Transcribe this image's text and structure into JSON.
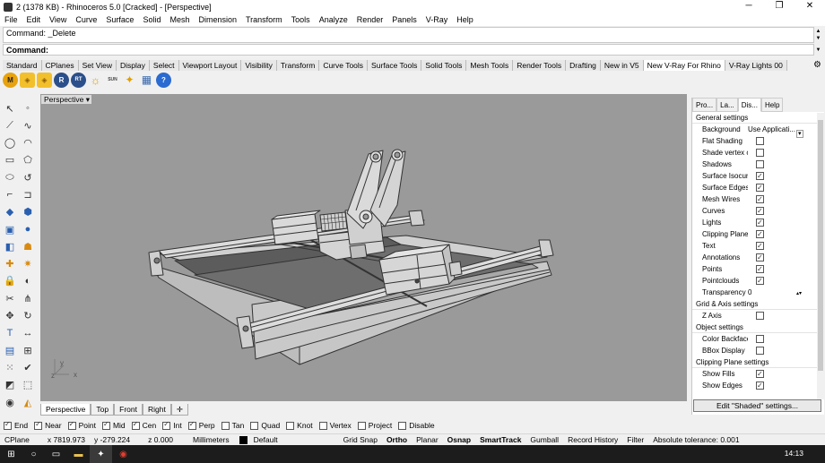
{
  "window": {
    "title": "2 (1378 KB) - Rhinoceros 5.0 [Cracked] - [Perspective]",
    "minimize": "─",
    "maximize": "❐",
    "close": "✕"
  },
  "menu": [
    "File",
    "Edit",
    "View",
    "Curve",
    "Surface",
    "Solid",
    "Mesh",
    "Dimension",
    "Transform",
    "Tools",
    "Analyze",
    "Render",
    "Panels",
    "V-Ray",
    "Help"
  ],
  "command": {
    "history": "Command: _Delete",
    "prompt": "Command:"
  },
  "toolbar_tabs": [
    "Standard",
    "CPlanes",
    "Set View",
    "Display",
    "Select",
    "Viewport Layout",
    "Visibility",
    "Transform",
    "Curve Tools",
    "Surface Tools",
    "Solid Tools",
    "Mesh Tools",
    "Render Tools",
    "Drafting",
    "New in V5",
    "New V-Ray For Rhino",
    "V-Ray Lights 00"
  ],
  "toolbar_active_tab": "New V-Ray For Rhino",
  "vray_buttons": [
    {
      "label": "M",
      "icon": "vray-options-icon"
    },
    {
      "label": "◈",
      "icon": "material-editor-icon"
    },
    {
      "label": "◈",
      "icon": "material-library-icon"
    },
    {
      "label": "R",
      "icon": "render-icon"
    },
    {
      "label": "RT",
      "icon": "rt-render-icon"
    },
    {
      "label": "☼",
      "icon": "sun-icon"
    },
    {
      "label": "SUN",
      "icon": "sun-light-icon"
    },
    {
      "label": "✦",
      "icon": "dome-light-icon"
    },
    {
      "label": "▦",
      "icon": "frame-buffer-icon"
    },
    {
      "label": "?",
      "icon": "help-icon"
    }
  ],
  "viewport": {
    "name": "Perspective",
    "axis_x": "x",
    "axis_y": "y",
    "axis_z": "z"
  },
  "viewport_tabs": [
    "Perspective",
    "Top",
    "Front",
    "Right"
  ],
  "viewport_add_tab": "✛",
  "panel": {
    "tabs": [
      "Pro...",
      "La...",
      "Dis...",
      "Help"
    ],
    "general_title": "General settings",
    "background_label": "Background",
    "background_value": "Use Applicati...",
    "rows": [
      {
        "label": "Flat Shading",
        "checked": false
      },
      {
        "label": "Shade vertex c...",
        "checked": false
      },
      {
        "label": "Shadows",
        "checked": false
      },
      {
        "label": "Surface Isocurv...",
        "checked": true
      },
      {
        "label": "Surface Edges",
        "checked": true
      },
      {
        "label": "Mesh Wires",
        "checked": true
      },
      {
        "label": "Curves",
        "checked": true
      },
      {
        "label": "Lights",
        "checked": true
      },
      {
        "label": "Clipping Planes",
        "checked": true
      },
      {
        "label": "Text",
        "checked": true
      },
      {
        "label": "Annotations",
        "checked": true
      },
      {
        "label": "Points",
        "checked": true
      },
      {
        "label": "Pointclouds",
        "checked": true
      }
    ],
    "transparency_label": "Transparency",
    "transparency_value": "0",
    "grid_title": "Grid & Axis settings",
    "grid_rows": [
      {
        "label": "Z Axis",
        "checked": false
      }
    ],
    "object_title": "Object settings",
    "object_rows": [
      {
        "label": "Color Backfaces",
        "checked": false
      },
      {
        "label": "BBox Display",
        "checked": false
      }
    ],
    "clip_title": "Clipping Plane settings",
    "clip_rows": [
      {
        "label": "Show Fills",
        "checked": true
      },
      {
        "label": "Show Edges",
        "checked": true
      }
    ],
    "edit_button": "Edit \"Shaded\" settings..."
  },
  "osnaps": [
    {
      "label": "End",
      "checked": true
    },
    {
      "label": "Near",
      "checked": true
    },
    {
      "label": "Point",
      "checked": true
    },
    {
      "label": "Mid",
      "checked": true
    },
    {
      "label": "Cen",
      "checked": true
    },
    {
      "label": "Int",
      "checked": true
    },
    {
      "label": "Perp",
      "checked": true
    },
    {
      "label": "Tan",
      "checked": false
    },
    {
      "label": "Quad",
      "checked": false
    },
    {
      "label": "Knot",
      "checked": false
    },
    {
      "label": "Vertex",
      "checked": false
    },
    {
      "label": "Project",
      "checked": false
    },
    {
      "label": "Disable",
      "checked": false
    }
  ],
  "status": {
    "cplane": "CPlane",
    "x": "x 7819.973",
    "y": "y -279.224",
    "z": "z 0.000",
    "units": "Millimeters",
    "layer": "Default",
    "grid_snap": "Grid Snap",
    "ortho": "Ortho",
    "planar": "Planar",
    "osnap": "Osnap",
    "smarttrack": "SmartTrack",
    "gumball": "Gumball",
    "record_history": "Record History",
    "filter": "Filter",
    "tolerance": "Absolute tolerance: 0.001"
  },
  "taskbar": {
    "clock": "14:13"
  },
  "colors": {
    "viewport_bg": "#9a9a9a",
    "model_fill": "#d2d2d2",
    "model_dark": "#333333"
  }
}
